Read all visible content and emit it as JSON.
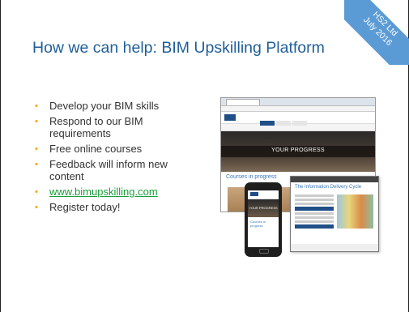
{
  "slide": {
    "title": "How we can help: BIM Upskilling Platform",
    "ribbon_line1": "HS2 Ltd",
    "ribbon_line2": "July 2016",
    "bullets": [
      "Develop your BIM skills",
      "Respond to our BIM requirements",
      "Free online courses",
      "Feedback will inform new content",
      "www.bimupskilling.com",
      "Register today!"
    ],
    "bullet_glyph": "•"
  },
  "collage": {
    "laptop_hero_text": "YOUR PROGRESS",
    "laptop_courses_text": "Courses in progress",
    "tablet_title": "The Information Delivery Cycle",
    "phone_hero_text": "YOUR PROGRESS",
    "phone_courses_text": "Courses in progress"
  },
  "colors": {
    "title": "#1f5e9a",
    "bullet": "#f0a30a",
    "link": "#1a9e3a",
    "ribbon": "#5b9bd5"
  }
}
